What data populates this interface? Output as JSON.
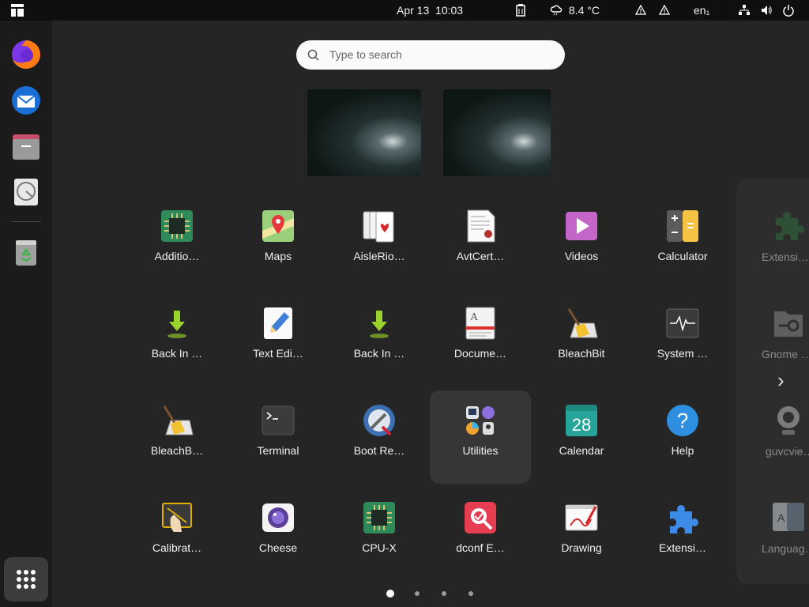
{
  "topbar": {
    "date": "Apr 13",
    "time": "10:03",
    "weather_temp": "8.4 °C",
    "language": "en₁",
    "icons": [
      "activities-icon",
      "clipboard-icon",
      "weather-icon",
      "warning-icon",
      "warning-icon",
      "network-icon",
      "volume-icon",
      "power-icon"
    ]
  },
  "dock": {
    "apps": [
      "firefox-icon",
      "thunderbird-icon",
      "files-icon",
      "disk-usage-icon",
      "trash-icon"
    ]
  },
  "search": {
    "placeholder": "Type to search"
  },
  "apps": [
    {
      "label": "Additio…",
      "icon": "chip-icon"
    },
    {
      "label": "Maps",
      "icon": "maps-icon"
    },
    {
      "label": "AisleRio…",
      "icon": "cards-icon"
    },
    {
      "label": "AvtCert…",
      "icon": "certificate-icon"
    },
    {
      "label": "Videos",
      "icon": "videos-icon"
    },
    {
      "label": "Calculator",
      "icon": "calculator-icon"
    },
    {
      "label": "Back In …",
      "icon": "download-arrow-icon"
    },
    {
      "label": "Text Edi…",
      "icon": "text-editor-icon"
    },
    {
      "label": "Back In …",
      "icon": "download-arrow-icon"
    },
    {
      "label": "Docume…",
      "icon": "document-viewer-icon"
    },
    {
      "label": "BleachBit",
      "icon": "bleachbit-icon"
    },
    {
      "label": "System …",
      "icon": "system-monitor-icon"
    },
    {
      "label": "BleachB…",
      "icon": "bleachbit-icon"
    },
    {
      "label": "Terminal",
      "icon": "terminal-icon"
    },
    {
      "label": "Boot Re…",
      "icon": "boot-repair-icon"
    },
    {
      "label": "Utilities",
      "icon": "utilities-folder-icon"
    },
    {
      "label": "Calendar",
      "icon": "calendar-icon"
    },
    {
      "label": "Help",
      "icon": "help-icon"
    },
    {
      "label": "Calibrat…",
      "icon": "calibrate-icon"
    },
    {
      "label": "Cheese",
      "icon": "cheese-icon"
    },
    {
      "label": "CPU-X",
      "icon": "chip-icon"
    },
    {
      "label": "dconf E…",
      "icon": "dconf-editor-icon"
    },
    {
      "label": "Drawing",
      "icon": "drawing-icon"
    },
    {
      "label": "Extensi…",
      "icon": "puzzle-icon"
    }
  ],
  "calendar_day": "28",
  "next_page": [
    {
      "label": "Extensi…",
      "icon": "puzzle-icon"
    },
    {
      "label": "Gnome …",
      "icon": "passwords-icon"
    },
    {
      "label": "guvcvie…",
      "icon": "webcam-icon"
    },
    {
      "label": "Languag…",
      "icon": "language-icon"
    }
  ],
  "pager": {
    "pages": 4,
    "current": 1
  },
  "colors": {
    "background": "#252525",
    "topbar": "#0f0f0f",
    "dock": "#1b1b1b",
    "accent": "#e95420"
  }
}
